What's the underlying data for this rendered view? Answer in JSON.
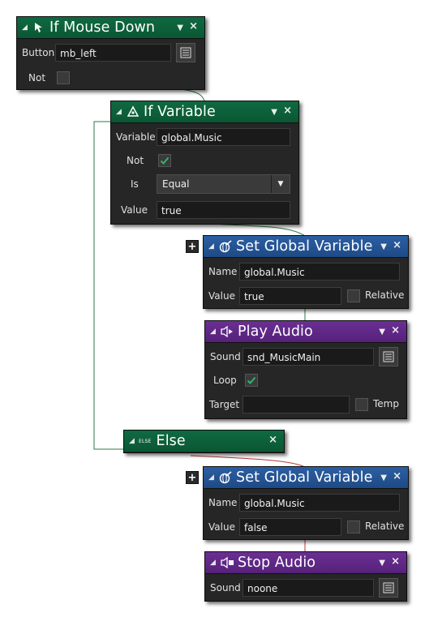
{
  "colors": {
    "header_green": "#0f6a41",
    "header_blue": "#2b5fa3",
    "header_purple": "#6b2f93",
    "body": "#262626",
    "wire_green": "#2d7a45",
    "wire_red": "#b23a3a",
    "check": "#2fb56a"
  },
  "if_mouse_down": {
    "title": "If Mouse Down",
    "icon": "mouse-icon",
    "button_label": "Button",
    "button_value": "mb_left",
    "not_label": "Not",
    "not_checked": false
  },
  "if_variable": {
    "title": "If Variable",
    "icon": "variable-branch-icon",
    "variable_label": "Variable",
    "variable_value": "global.Music",
    "not_label": "Not",
    "not_checked": true,
    "is_label": "Is",
    "is_value": "Equal",
    "value_label": "Value",
    "value_value": "true"
  },
  "set_global_1": {
    "title": "Set Global Variable",
    "icon": "globe-icon",
    "name_label": "Name",
    "name_value": "global.Music",
    "value_label": "Value",
    "value_value": "true",
    "relative_label": "Relative",
    "relative_checked": false
  },
  "play_audio": {
    "title": "Play Audio",
    "icon": "speaker-play-icon",
    "sound_label": "Sound",
    "sound_value": "snd_MusicMain",
    "loop_label": "Loop",
    "loop_checked": true,
    "target_label": "Target",
    "target_value": "",
    "temp_label": "Temp",
    "temp_checked": false
  },
  "else_block": {
    "title": "Else",
    "tag": "ELSE"
  },
  "set_global_2": {
    "title": "Set Global Variable",
    "icon": "globe-icon",
    "name_label": "Name",
    "name_value": "global.Music",
    "value_label": "Value",
    "value_value": "false",
    "relative_label": "Relative",
    "relative_checked": false
  },
  "stop_audio": {
    "title": "Stop Audio",
    "icon": "speaker-stop-icon",
    "sound_label": "Sound",
    "sound_value": "noone"
  },
  "plus_symbol": "+"
}
